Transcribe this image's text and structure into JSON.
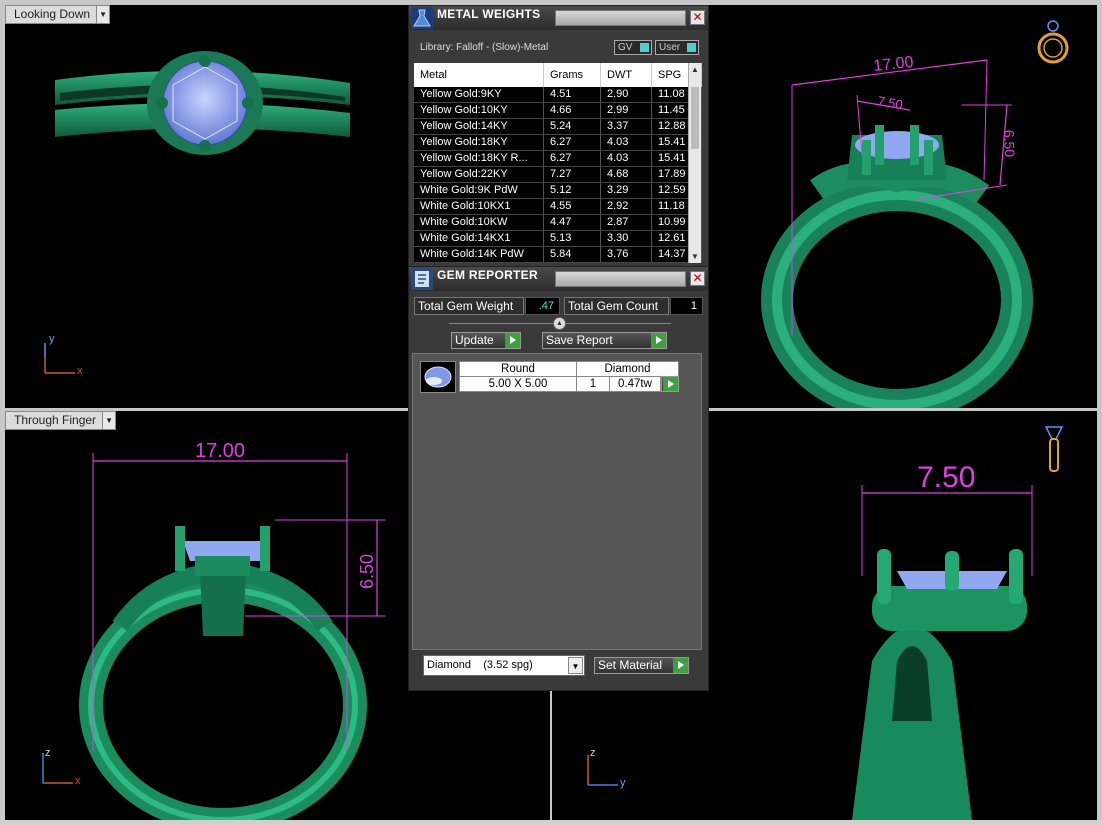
{
  "viewports": {
    "top_left": {
      "label": "Looking Down",
      "axis_v": "y",
      "axis_h": "x"
    },
    "top_right": {},
    "bottom_left": {
      "label": "Through Finger",
      "axis_v": "z",
      "axis_h": "x"
    },
    "bottom_right": {
      "axis_v": "z",
      "axis_h": "y"
    }
  },
  "dimensions": {
    "tr_width": "17.00",
    "tr_depth": "7.50",
    "tr_height": "6.50",
    "bl_width": "17.00",
    "bl_height": "6.50",
    "br_depth": "7.50"
  },
  "metal_weights": {
    "title": "METAL WEIGHTS",
    "library": "Library: Falloff - (Slow)-Metal",
    "toggle_gv": "GV",
    "toggle_user": "User",
    "headers": [
      "Metal",
      "Grams",
      "DWT",
      "SPG"
    ],
    "rows": [
      [
        "Yellow Gold:9KY",
        "4.51",
        "2.90",
        "11.08"
      ],
      [
        "Yellow Gold:10KY",
        "4.66",
        "2.99",
        "11.45"
      ],
      [
        "Yellow Gold:14KY",
        "5.24",
        "3.37",
        "12.88"
      ],
      [
        "Yellow Gold:18KY",
        "6.27",
        "4.03",
        "15.41"
      ],
      [
        "Yellow Gold:18KY R...",
        "6.27",
        "4.03",
        "15.41"
      ],
      [
        "Yellow Gold:22KY",
        "7.27",
        "4.68",
        "17.89"
      ],
      [
        "White Gold:9K PdW",
        "5.12",
        "3.29",
        "12.59"
      ],
      [
        "White Gold:10KX1",
        "4.55",
        "2.92",
        "11.18"
      ],
      [
        "White Gold:10KW",
        "4.47",
        "2.87",
        "10.99"
      ],
      [
        "White Gold:14KX1",
        "5.13",
        "3.30",
        "12.61"
      ],
      [
        "White Gold:14K PdW",
        "5.84",
        "3.76",
        "14.37"
      ]
    ]
  },
  "gem_reporter": {
    "title": "GEM REPORTER",
    "total_weight_label": "Total Gem Weight",
    "total_weight_value": ".47",
    "total_count_label": "Total Gem Count",
    "total_count_value": "1",
    "update_label": "Update",
    "save_report_label": "Save Report",
    "gem": {
      "shape": "Round",
      "material": "Diamond",
      "size": "5.00 X 5.00",
      "count": "1",
      "weight": "0.47tw"
    },
    "material_select": "Diamond    (3.52 spg)",
    "set_material_label": "Set Material"
  },
  "colors": {
    "ring_green": "#1f8a60",
    "gem_blue": "#8fa8f0",
    "dimension_magenta": "#e040e0",
    "go_button_green": "#3fa040"
  }
}
